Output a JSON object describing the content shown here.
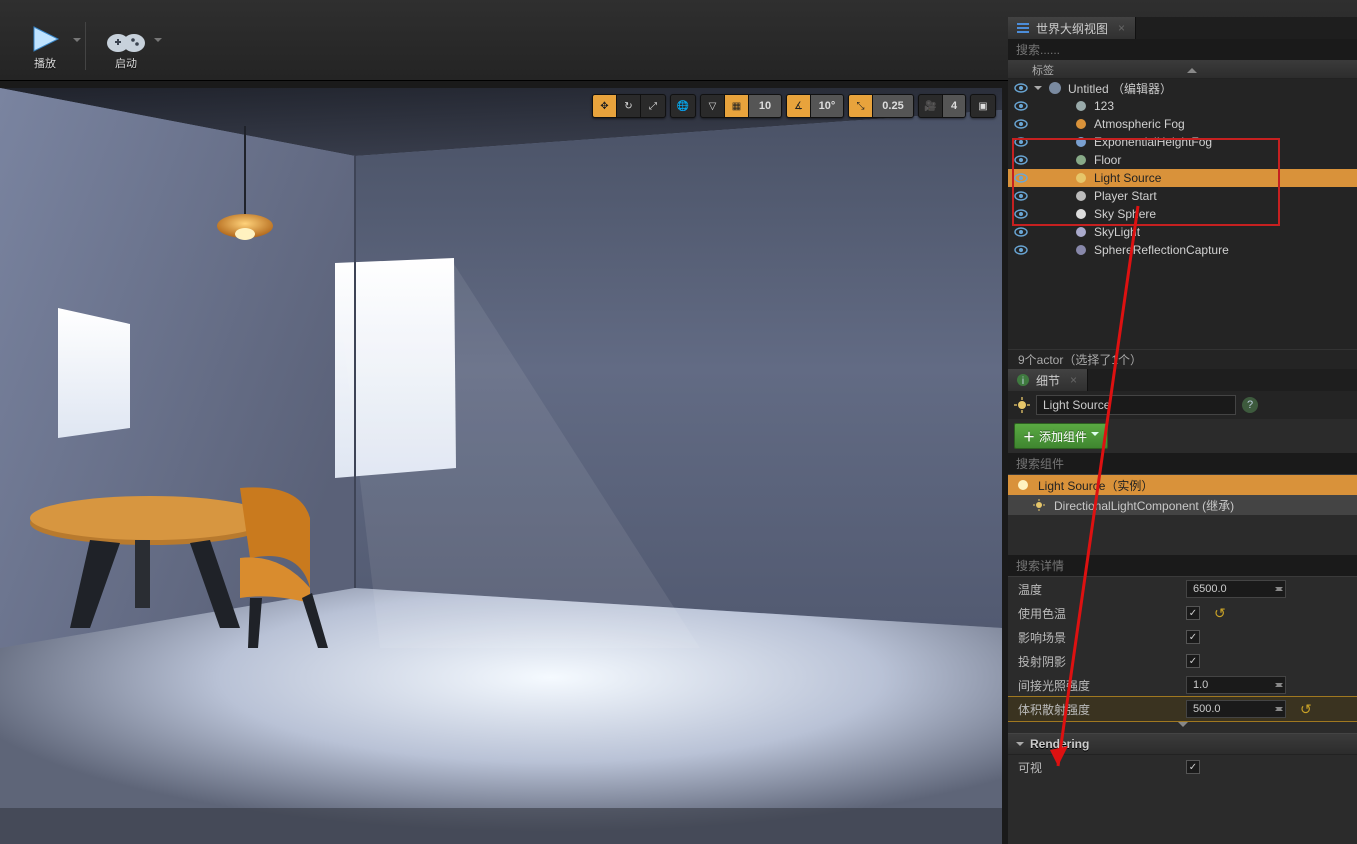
{
  "toolbar": {
    "play": "播放",
    "launch": "启动"
  },
  "viewportToolbar": {
    "snap": "10",
    "angle": "10°",
    "scale": "0.25",
    "cam": "4"
  },
  "outliner": {
    "tabTitle": "世界大纲视图",
    "searchPlaceholder": "搜索......",
    "header": "标签",
    "root": "Untitled （编辑器）",
    "items": [
      {
        "name": "123"
      },
      {
        "name": "Atmospheric Fog"
      },
      {
        "name": "ExponentialHeightFog"
      },
      {
        "name": "Floor"
      },
      {
        "name": "Light Source",
        "selected": true
      },
      {
        "name": "Player Start"
      },
      {
        "name": "Sky Sphere"
      },
      {
        "name": "SkyLight"
      },
      {
        "name": "SphereReflectionCapture"
      }
    ],
    "status": "9个actor（选择了1个）"
  },
  "details": {
    "tabTitle": "细节",
    "objectName": "Light Source",
    "addComponent": "添加组件",
    "componentSearchPlaceholder": "搜索组件",
    "instanceLabel": "Light Source（实例）",
    "childComponent": "DirectionalLightComponent (继承)",
    "detailSearchPlaceholder": "搜索详情",
    "props": {
      "temperature": {
        "label": "温度",
        "value": "6500.0"
      },
      "useColorTemp": {
        "label": "使用色温",
        "checked": true,
        "revert": true
      },
      "affectsWorld": {
        "label": "影响场景",
        "checked": true
      },
      "castShadows": {
        "label": "投射阴影",
        "checked": true
      },
      "indirectIntensity": {
        "label": "间接光照强度",
        "value": "1.0"
      },
      "volScatterIntensity": {
        "label": "体积散射强度",
        "value": "500.0",
        "revert": true
      }
    },
    "renderingHeader": "Rendering",
    "visibleLabel": "可视"
  }
}
